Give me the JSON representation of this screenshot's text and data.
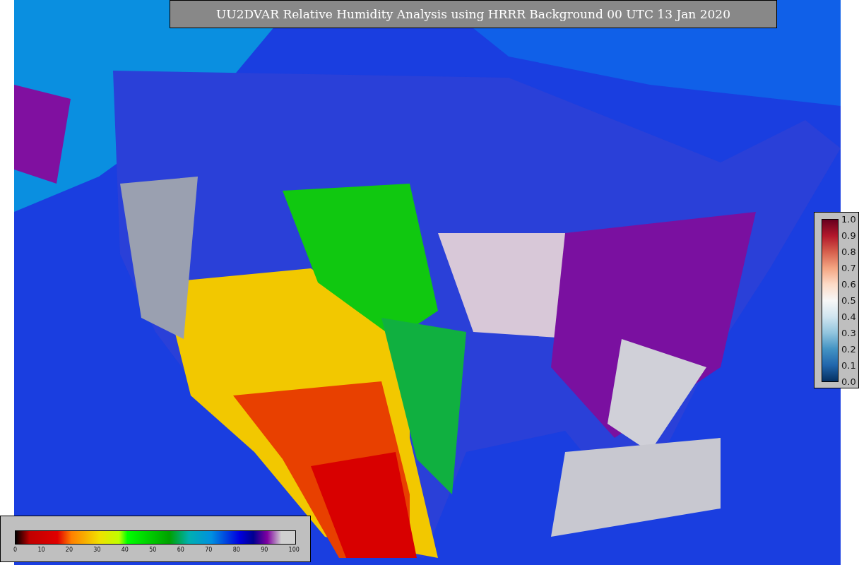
{
  "title": "UU2DVAR Relative Humidity Analysis using HRRR Background 00 UTC 13 Jan 2020",
  "error_scale": {
    "ticks": [
      "1.0",
      "0.9",
      "0.8",
      "0.7",
      "0.6",
      "0.5",
      "0.4",
      "0.3",
      "0.2",
      "0.1",
      "0.0"
    ]
  },
  "humidity_scale": {
    "ticks": [
      "0",
      "10",
      "20",
      "30",
      "40",
      "50",
      "60",
      "70",
      "80",
      "90",
      "100"
    ]
  }
}
